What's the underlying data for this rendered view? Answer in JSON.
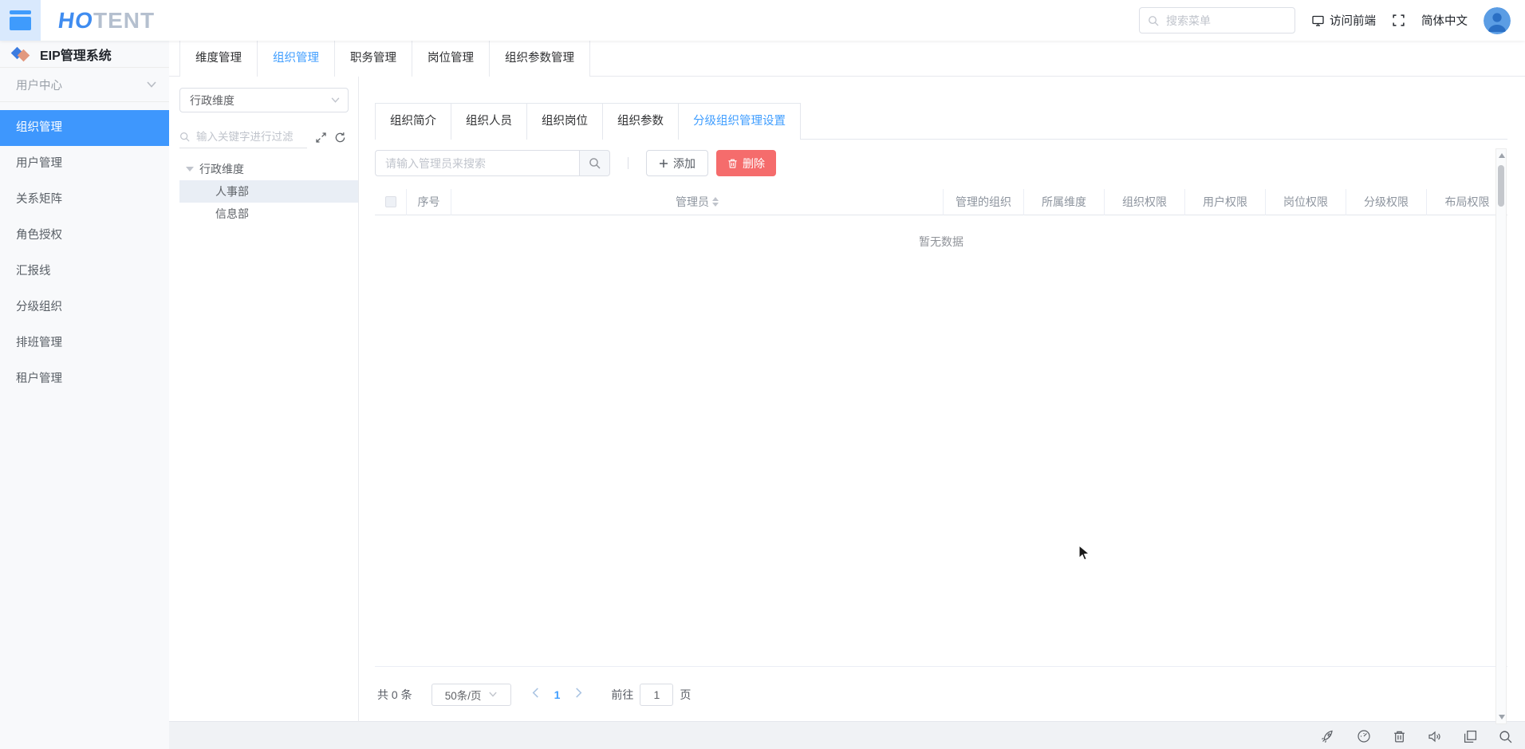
{
  "header": {
    "logo_blue": "HO",
    "logo_gray": "TENT",
    "menu_search_placeholder": "搜索菜单",
    "visit_frontend": "访问前端",
    "language": "简体中文"
  },
  "sidebar": {
    "title": "EIP管理系统",
    "section": "用户中心",
    "items": [
      {
        "label": "组织管理",
        "active": true
      },
      {
        "label": "用户管理",
        "active": false
      },
      {
        "label": "关系矩阵",
        "active": false
      },
      {
        "label": "角色授权",
        "active": false
      },
      {
        "label": "汇报线",
        "active": false
      },
      {
        "label": "分级组织",
        "active": false
      },
      {
        "label": "排班管理",
        "active": false
      },
      {
        "label": "租户管理",
        "active": false
      }
    ]
  },
  "top_tabs": [
    {
      "label": "维度管理",
      "active": false
    },
    {
      "label": "组织管理",
      "active": true
    },
    {
      "label": "职务管理",
      "active": false
    },
    {
      "label": "岗位管理",
      "active": false
    },
    {
      "label": "组织参数管理",
      "active": false
    }
  ],
  "tree_panel": {
    "dimension_select": "行政维度",
    "filter_placeholder": "输入关键字进行过滤",
    "root_label": "行政维度",
    "nodes": [
      {
        "label": "人事部",
        "selected": true
      },
      {
        "label": "信息部",
        "selected": false
      }
    ]
  },
  "detail_tabs": [
    {
      "label": "组织简介",
      "active": false
    },
    {
      "label": "组织人员",
      "active": false
    },
    {
      "label": "组织岗位",
      "active": false
    },
    {
      "label": "组织参数",
      "active": false
    },
    {
      "label": "分级组织管理设置",
      "active": true
    }
  ],
  "toolbar": {
    "search_placeholder": "请输入管理员来搜索",
    "add_label": "添加",
    "delete_label": "删除"
  },
  "table": {
    "columns": [
      "序号",
      "管理员",
      "管理的组织",
      "所属维度",
      "组织权限",
      "用户权限",
      "岗位权限",
      "分级权限",
      "布局权限"
    ],
    "empty_text": "暂无数据"
  },
  "pagination": {
    "total_text": "共 0 条",
    "page_size": "50条/页",
    "current_page": "1",
    "goto_label": "前往",
    "goto_value": "1",
    "page_unit": "页"
  },
  "icons": {
    "header": [
      "search-icon",
      "monitor-icon",
      "fullscreen-icon"
    ],
    "tree_tools": [
      "expand-icon",
      "refresh-icon"
    ],
    "footer": [
      "rocket-icon",
      "performance-icon",
      "trash-icon",
      "speaker-icon",
      "windows-icon",
      "search-icon"
    ]
  },
  "colors": {
    "primary": "#409eff",
    "sidebar_active": "#3e97fd",
    "danger": "#f56c6c",
    "header_tile": "#d9e9fd",
    "tree_selected_bg": "#e9eef5",
    "page_bg": "#f0f2f5"
  }
}
